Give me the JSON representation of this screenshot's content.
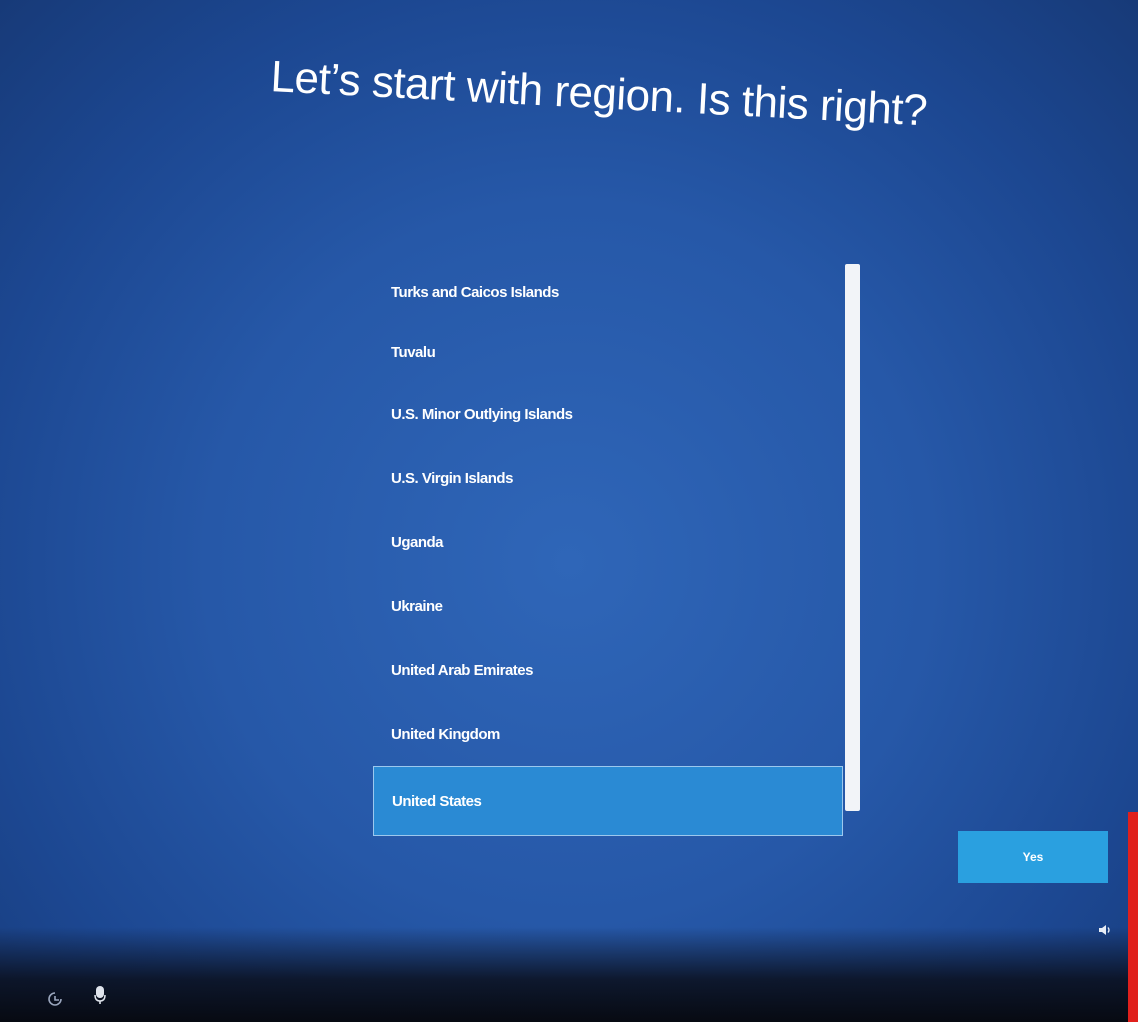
{
  "header": {
    "title": "Let’s start with region. Is this right?"
  },
  "region_list": {
    "items": [
      {
        "label": "Turks and Caicos Islands"
      },
      {
        "label": "Tuvalu"
      },
      {
        "label": "U.S. Minor Outlying Islands"
      },
      {
        "label": "U.S. Virgin Islands"
      },
      {
        "label": "Uganda"
      },
      {
        "label": "Ukraine"
      },
      {
        "label": "United Arab Emirates"
      },
      {
        "label": "United Kingdom"
      },
      {
        "label": "United States"
      }
    ],
    "selected": "United States"
  },
  "actions": {
    "yes_label": "Yes"
  },
  "taskbar": {
    "icons": [
      "ease-of-access-icon",
      "microphone-icon",
      "volume-icon"
    ]
  },
  "colors": {
    "background": "#2658a8",
    "selected_item": "#2a8ad4",
    "button": "#2aa0e0",
    "scrollbar": "#f2f4f8"
  }
}
